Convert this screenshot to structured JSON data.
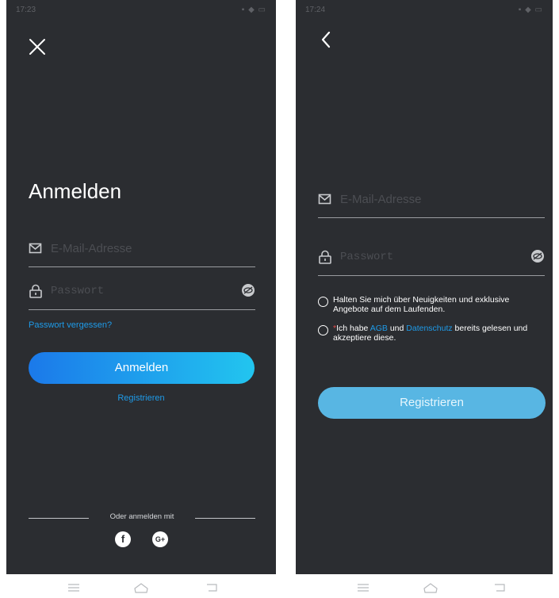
{
  "login": {
    "status_time": "17:23",
    "title": "Anmelden",
    "email_placeholder": "E-Mail-Adresse",
    "password_placeholder": "Passwort",
    "forgot_password": "Passwort vergessen?",
    "login_button": "Anmelden",
    "register_link": "Registrieren",
    "social_divider": "Oder anmelden mit",
    "social_facebook": "f",
    "social_google": "G+"
  },
  "register": {
    "status_time": "17:24",
    "email_placeholder": "E-Mail-Adresse",
    "password_placeholder": "Passwort",
    "newsletter_text": "Halten Sie mich über Neuigkeiten und exklusive Angebote auf dem Laufenden.",
    "terms_required_mark": "*",
    "terms_prefix": "Ich habe ",
    "terms_agb": "AGB",
    "terms_and": " und ",
    "terms_privacy": "Datenschutz",
    "terms_suffix": " bereits gelesen und akzeptiere diese.",
    "register_button": "Registrieren"
  },
  "icons": {
    "close": "close-icon",
    "back": "back-arrow-icon",
    "mail": "mail-icon",
    "lock": "lock-icon",
    "eye": "hide-password-icon",
    "nav_menu": "menu-icon",
    "nav_home": "home-icon",
    "nav_back": "back-icon"
  },
  "colors": {
    "background": "#2b2d31",
    "link": "#1e9be9",
    "gradient_start": "#1b79ea",
    "gradient_end": "#22c5ef",
    "register_button": "#58b6e3"
  }
}
